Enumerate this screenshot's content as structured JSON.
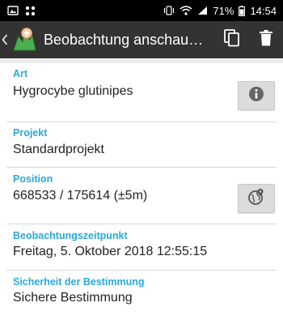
{
  "statusbar": {
    "battery_percent": "71%",
    "time": "14:54"
  },
  "toolbar": {
    "title": "Beobachtung anschau…"
  },
  "fields": [
    {
      "label": "Art",
      "value": "Hygrocybe glutinipes"
    },
    {
      "label": "Projekt",
      "value": "Standardprojekt"
    },
    {
      "label": "Position",
      "value": "668533 / 175614 (±5m)"
    },
    {
      "label": "Beobachtungszeitpunkt",
      "value": "Freitag, 5. Oktober 2018 12:55:15"
    },
    {
      "label": "Sicherheit der Bestimmung",
      "value": "Sichere Bestimmung"
    }
  ],
  "colors": {
    "toolbar_bg": "#333333",
    "label_accent": "#29a9d8",
    "app_logo_green": "#4caf50"
  },
  "icons": {
    "copy": "copy-icon",
    "delete": "trash-icon",
    "info": "info-icon",
    "map": "globe-pin-icon"
  }
}
